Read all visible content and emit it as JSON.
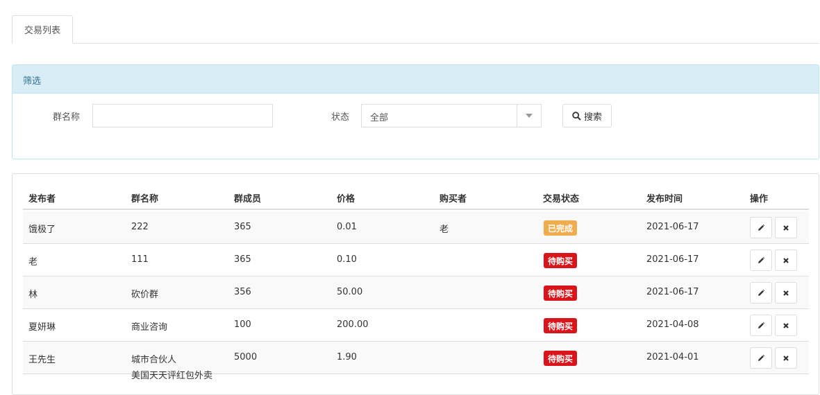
{
  "tabs": [
    {
      "label": "交易列表"
    }
  ],
  "filter": {
    "heading": "筛选",
    "group_name_label": "群名称",
    "group_name_value": "",
    "status_label": "状态",
    "status_value": "全部",
    "search_label": "搜索"
  },
  "table": {
    "headers": [
      "发布者",
      "群名称",
      "群成员",
      "价格",
      "购买者",
      "交易状态",
      "发布时间",
      "操作"
    ],
    "rows": [
      {
        "publisher": "饿极了",
        "group": "222",
        "members": "365",
        "price": "0.01",
        "buyer": "老",
        "status": "已完成",
        "status_type": "done",
        "date": "2021-06-17"
      },
      {
        "publisher": "老",
        "group": "111",
        "members": "365",
        "price": "0.10",
        "buyer": "",
        "status": "待购买",
        "status_type": "pending",
        "date": "2021-06-17"
      },
      {
        "publisher": "林",
        "group": "砍价群",
        "members": "356",
        "price": "50.00",
        "buyer": "",
        "status": "待购买",
        "status_type": "pending",
        "date": "2021-06-17"
      },
      {
        "publisher": "夏妍琳",
        "group": "商业咨询",
        "members": "100",
        "price": "200.00",
        "buyer": "",
        "status": "待购买",
        "status_type": "pending",
        "date": "2021-04-08"
      },
      {
        "publisher": "王先生",
        "group": "城市合伙人",
        "members": "5000",
        "price": "1.90",
        "buyer": "",
        "status": "待购买",
        "status_type": "pending",
        "date": "2021-04-01"
      }
    ],
    "partial_row_text": "美国天天评红包外卖"
  },
  "colors": {
    "status_done": "#f0ad4e",
    "status_pending": "#d9151b",
    "filter_heading_bg": "#d9edf7"
  },
  "icons": {
    "edit": "pencil-icon",
    "delete": "close-icon",
    "search": "search-icon",
    "dropdown": "chevron-down-icon"
  }
}
